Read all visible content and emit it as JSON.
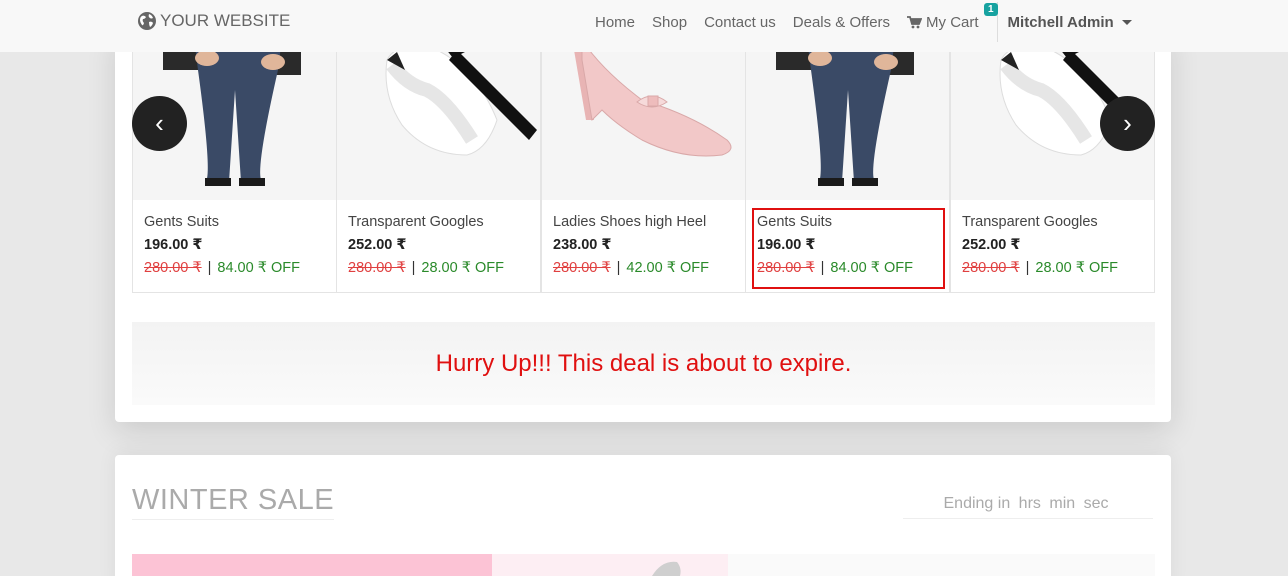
{
  "nav": {
    "brand": "YOUR WEBSITE",
    "links": [
      "Home",
      "Shop",
      "Contact us",
      "Deals & Offers"
    ],
    "cart_label": "My Cart",
    "cart_count": "1",
    "user": "Mitchell Admin"
  },
  "carousel": {
    "products": [
      {
        "name": "Gents Suits",
        "price": "196.00 ₹",
        "old_price": "280.00 ₹",
        "separator": "|",
        "off": "84.00 ₹ OFF"
      },
      {
        "name": "Transparent Googles",
        "price": "252.00 ₹",
        "old_price": "280.00 ₹",
        "separator": "|",
        "off": "28.00 ₹ OFF"
      },
      {
        "name": "Ladies Shoes high Heel",
        "price": "238.00 ₹",
        "old_price": "280.00 ₹",
        "separator": "|",
        "off": "42.00 ₹ OFF"
      },
      {
        "name": "Gents Suits",
        "price": "196.00 ₹",
        "old_price": "280.00 ₹",
        "separator": "|",
        "off": "84.00 ₹ OFF"
      },
      {
        "name": "Transparent Googles",
        "price": "252.00 ₹",
        "old_price": "280.00 ₹",
        "separator": "|",
        "off": "28.00 ₹ OFF"
      }
    ],
    "prev": "‹",
    "next": "›"
  },
  "hurry_text": "Hurry Up!!! This deal is about to expire.",
  "winter": {
    "title": "WINTER SALE",
    "ending_label": "Ending in",
    "hrs": "hrs",
    "min": "min",
    "sec": "sec"
  },
  "colors": {
    "accent_red": "#e01010",
    "discount_green": "#2a8a2a",
    "badge_teal": "#17a2a0"
  }
}
